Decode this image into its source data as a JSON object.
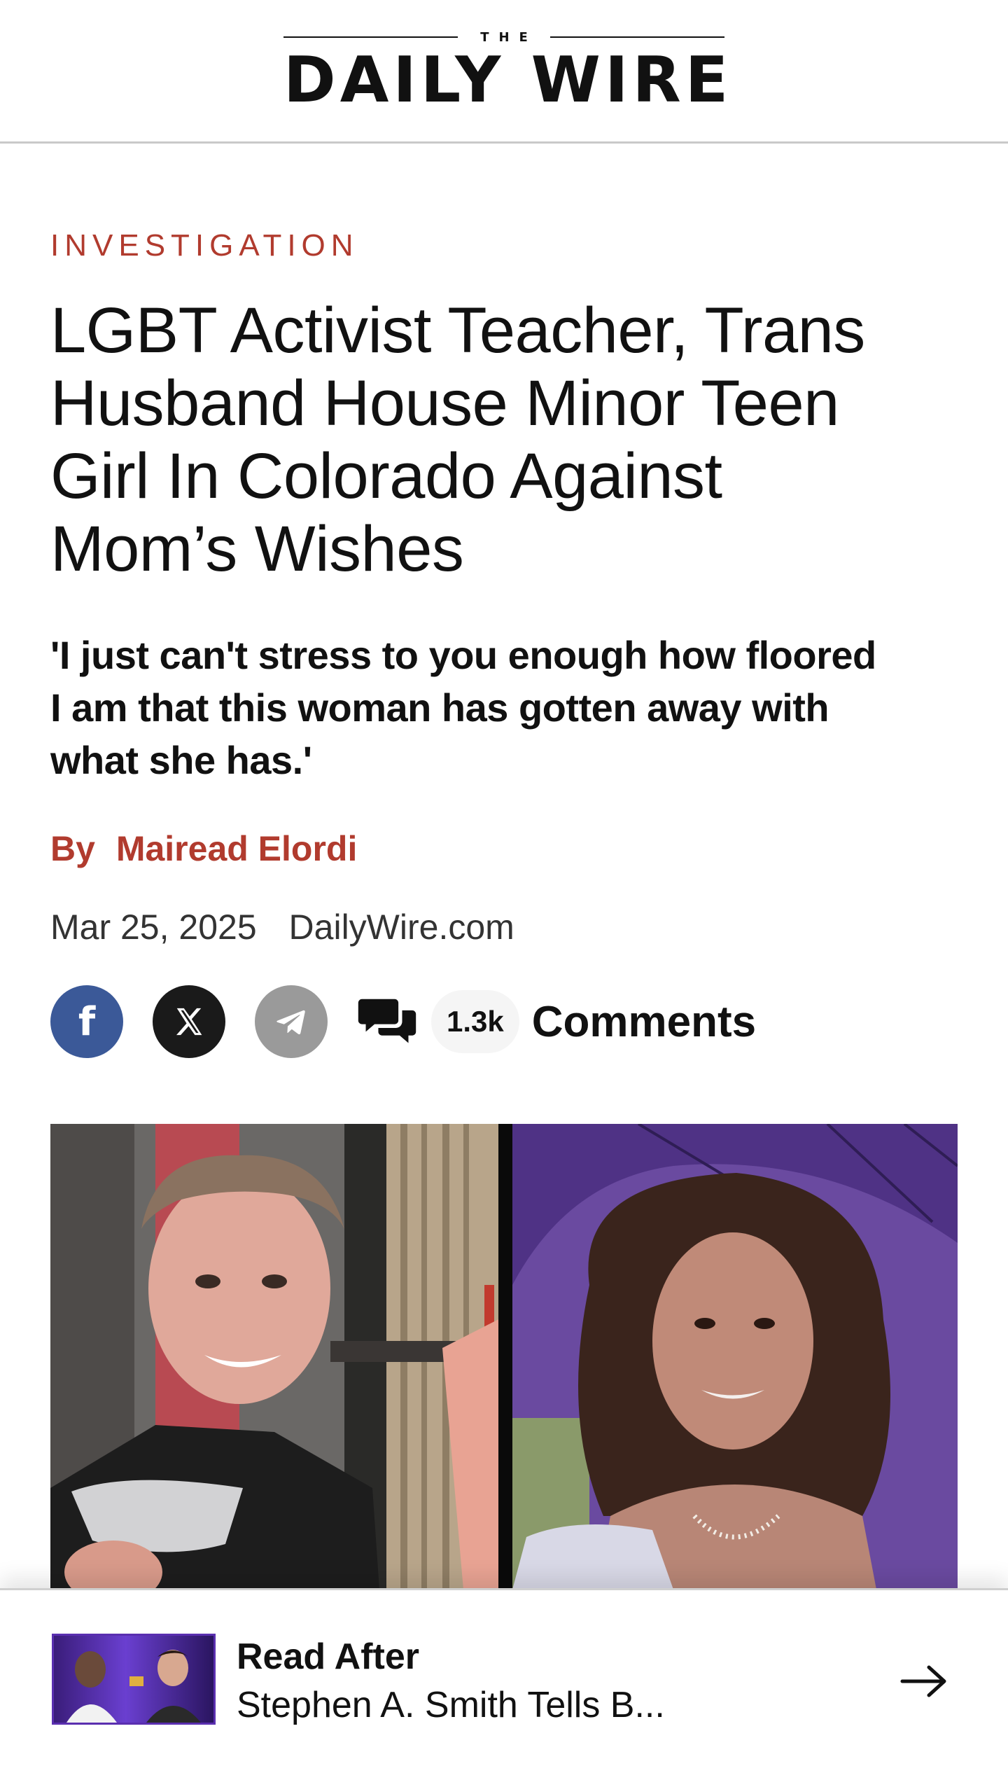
{
  "header": {
    "logo_the": "THE",
    "logo_main": "DAILY WIRE"
  },
  "article": {
    "kicker": "INVESTIGATION",
    "headline_lines": [
      "LGBT Activist Teacher, Trans",
      "Husband House Minor Teen",
      "Girl In Colorado Against",
      "Mom’s Wishes"
    ],
    "dek_lines": [
      "'I just can't stress to you enough how floored",
      "I am that this woman has gotten away with",
      "what she has.'"
    ],
    "byline_prefix": "By",
    "author": "Mairead Elordi",
    "date": "Mar 25, 2025",
    "source": "DailyWire.com"
  },
  "share": {
    "facebook_icon": "facebook-icon",
    "x_icon": "x-icon",
    "telegram_icon": "telegram-icon",
    "comments_icon": "comments-icon",
    "comment_count": "1.3k",
    "comments_label": "Comments",
    "colors": {
      "facebook": "#3b5998",
      "x": "#1a1a1a",
      "telegram": "#9a9a9a"
    }
  },
  "read_after": {
    "title": "Read After",
    "subtitle": "Stephen A. Smith Tells B...",
    "arrow_icon": "arrow-right-icon"
  },
  "colors": {
    "accent": "#b13b2e"
  }
}
